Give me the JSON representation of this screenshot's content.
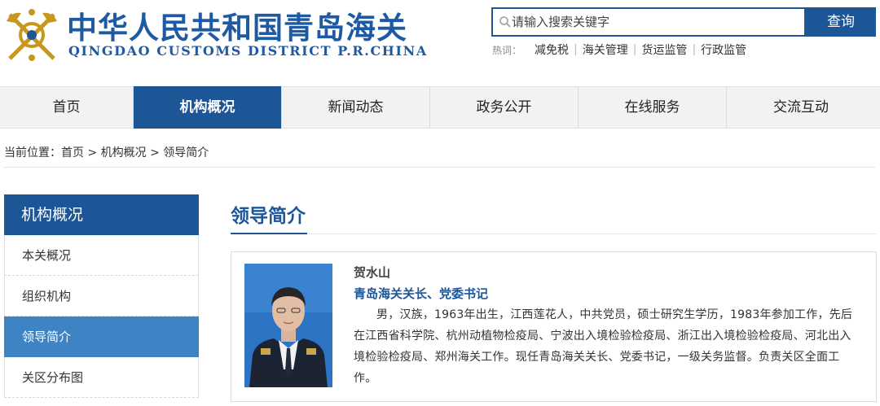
{
  "header": {
    "title_cn": "中华人民共和国青岛海关",
    "title_en": "QINGDAO CUSTOMS DISTRICT P.R.CHINA",
    "logo_icon": "customs-emblem-icon"
  },
  "search": {
    "placeholder": "请输入搜索关键字",
    "value": "",
    "button_label": "查询",
    "hot_label": "热词：",
    "hot_words": [
      "减免税",
      "海关管理",
      "货运监管",
      "行政监管"
    ]
  },
  "nav": {
    "items": [
      "首页",
      "机构概况",
      "新闻动态",
      "政务公开",
      "在线服务",
      "交流互动"
    ],
    "active": "机构概况"
  },
  "breadcrumb": {
    "prefix": "当前位置：",
    "items": [
      "首页",
      "机构概况",
      "领导简介"
    ],
    "separator": ">"
  },
  "sidebar": {
    "heading": "机构概况",
    "items": [
      "本关概况",
      "组织机构",
      "领导简介",
      "关区分布图"
    ],
    "active": "领导简介"
  },
  "content": {
    "title": "领导简介",
    "profile": {
      "name": "贺水山",
      "position": "青岛海关关长、党委书记",
      "bio": "男，汉族，1963年出生，江西莲花人，中共党员，硕士研究生学历，1983年参加工作，先后在江西省科学院、杭州动植物检疫局、宁波出入境检验检疫局、浙江出入境检验检疫局、河北出入境检验检疫局、郑州海关工作。现任青岛海关关长、党委书记，一级关务监督。负责关区全面工作。"
    }
  },
  "colors": {
    "brand_blue": "#1d5697",
    "active_side": "#3e84c4",
    "nav_bg": "#f2f2f2"
  }
}
